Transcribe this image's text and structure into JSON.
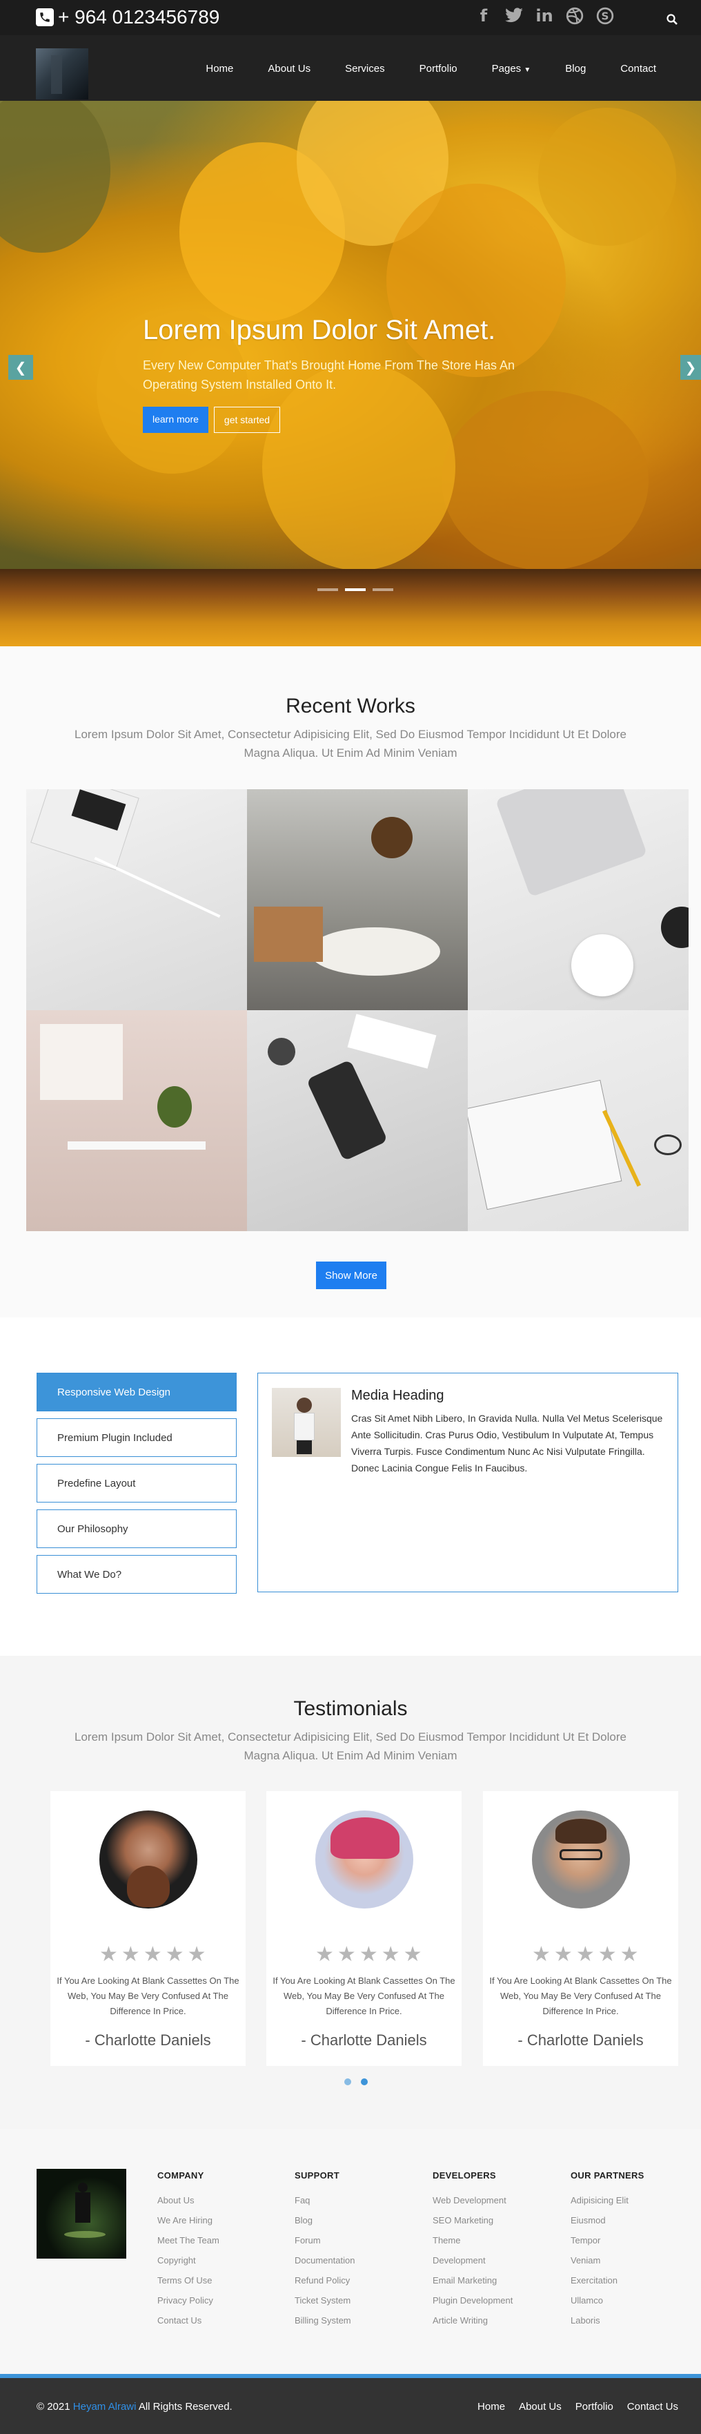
{
  "topbar": {
    "phone": "+ 964 0123456789",
    "social_icons": [
      "facebook-icon",
      "twitter-icon",
      "linkedin-icon",
      "dribbble-icon",
      "skype-icon"
    ],
    "search_icon": "search-icon"
  },
  "nav": {
    "items": [
      "Home",
      "About Us",
      "Services",
      "Portfolio",
      "Pages",
      "Blog",
      "Contact"
    ]
  },
  "hero": {
    "title": "Lorem Ipsum Dolor Sit Amet.",
    "text": "Every New Computer That's Brought Home From The Store Has An Operating System Installed Onto It.",
    "btn_primary": "learn more",
    "btn_secondary": "get started",
    "slides": 3,
    "active_slide": 2
  },
  "recent": {
    "title": "Recent Works",
    "subtitle": "Lorem Ipsum Dolor Sit Amet, Consectetur Adipisicing Elit, Sed Do Eiusmod Tempor Incididunt Ut Et Dolore Magna Aliqua. Ut Enim Ad Minim Veniam",
    "button": "Show More"
  },
  "tabs": {
    "items": [
      "Responsive Web Design",
      "Premium Plugin Included",
      "Predefine Layout",
      "Our Philosophy",
      "What We Do?"
    ],
    "active": 0,
    "media_heading": "Media Heading",
    "media_text": "Cras Sit Amet Nibh Libero, In Gravida Nulla. Nulla Vel Metus Scelerisque Ante Sollicitudin. Cras Purus Odio, Vestibulum In Vulputate At, Tempus Viverra Turpis. Fusce Condimentum Nunc Ac Nisi Vulputate Fringilla. Donec Lacinia Congue Felis In Faucibus."
  },
  "testimonials": {
    "title": "Testimonials",
    "subtitle": "Lorem Ipsum Dolor Sit Amet, Consectetur Adipisicing Elit, Sed Do Eiusmod Tempor Incididunt Ut Et Dolore Magna Aliqua. Ut Enim Ad Minim Veniam",
    "cards": [
      {
        "text": "If You Are Looking At Blank Cassettes On The Web, You May Be Very Confused At The Difference In Price.",
        "name": "- Charlotte Daniels"
      },
      {
        "text": "If You Are Looking At Blank Cassettes On The Web, You May Be Very Confused At The Difference In Price.",
        "name": "- Charlotte Daniels"
      },
      {
        "text": "If You Are Looking At Blank Cassettes On The Web, You May Be Very Confused At The Difference In Price.",
        "name": "- Charlotte Daniels"
      }
    ],
    "star_glyph": "★"
  },
  "footer": {
    "columns": [
      {
        "heading": "COMPANY",
        "links": [
          "About Us",
          "We Are Hiring",
          "Meet The Team",
          "Copyright",
          "Terms Of Use",
          "Privacy Policy",
          "Contact Us"
        ]
      },
      {
        "heading": "SUPPORT",
        "links": [
          "Faq",
          "Blog",
          "Forum",
          "Documentation",
          "Refund Policy",
          "Ticket System",
          "Billing System"
        ]
      },
      {
        "heading": "DEVELOPERS",
        "links": [
          "Web Development",
          "SEO Marketing",
          "Theme",
          "Development",
          "Email Marketing",
          "Plugin Development",
          "Article Writing"
        ]
      },
      {
        "heading": "OUR PARTNERS",
        "links": [
          "Adipisicing Elit",
          "Eiusmod",
          "Tempor",
          "Veniam",
          "Exercitation",
          "Ullamco",
          "Laboris"
        ]
      }
    ],
    "copyright_prefix": "© 2021",
    "copyright_name": "Heyam Alrawi",
    "copyright_suffix": "All Rights Reserved.",
    "bottom_nav": [
      "Home",
      "About Us",
      "Portfolio",
      "Contact Us"
    ]
  },
  "colors": {
    "accent": "#1e7ef0",
    "tab_active": "#3d94d9",
    "dark": "#222222"
  }
}
